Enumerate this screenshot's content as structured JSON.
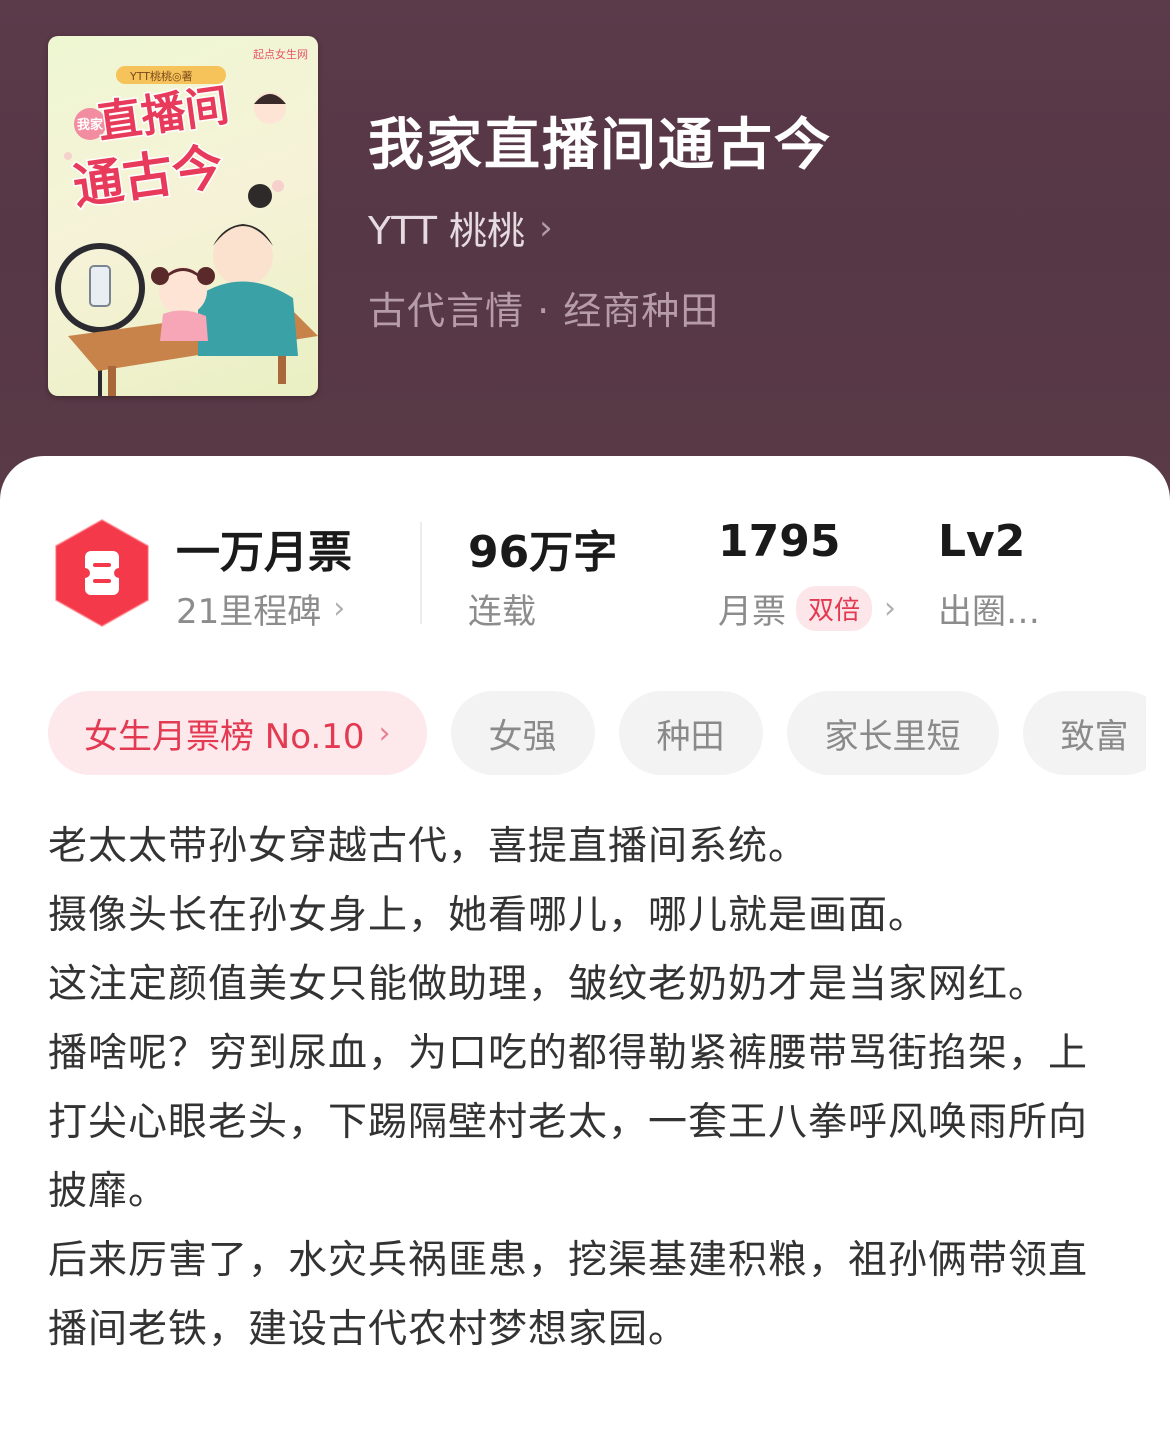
{
  "book": {
    "title": "我家直播间通古今",
    "author": "YTT 桃桃",
    "genre": "古代言情 · 经商种田",
    "cover": {
      "publisher": "起点女生网",
      "author_line": "YTT桃桃◎著",
      "title_small": "我家",
      "title_line1": "直播间",
      "title_line2": "通古今"
    }
  },
  "stats": {
    "milestone": {
      "value": "一万月票",
      "label": "21里程碑"
    },
    "words": {
      "value": "96万字",
      "label": "连载"
    },
    "tickets": {
      "value": "1795",
      "label": "月票",
      "badge": "双倍"
    },
    "level": {
      "value": "Lv2",
      "label": "出圈…"
    }
  },
  "tags": [
    "女生月票榜 No.10",
    "女强",
    "种田",
    "家长里短",
    "致富"
  ],
  "description": [
    "老太太带孙女穿越古代，喜提直播间系统。",
    "摄像头长在孙女身上，她看哪儿，哪儿就是画面。",
    "这注定颜值美女只能做助理，皱纹老奶奶才是当家网红。",
    "播啥呢？穷到尿血，为口吃的都得勒紧裤腰带骂街掐架，上打尖心眼老头，下踢隔壁村老太，一套王八拳呼风唤雨所向披靡。",
    "后来厉害了，水灾兵祸匪患，挖渠基建积粮，祖孙俩带领直播间老铁，建设古代农村梦想家园。"
  ],
  "colors": {
    "header_bg": "#5a3a47",
    "accent_red": "#e33a52",
    "tag_bg": "#f3f3f3"
  },
  "icons": [
    "ticket-icon",
    "chevron-right-icon"
  ]
}
